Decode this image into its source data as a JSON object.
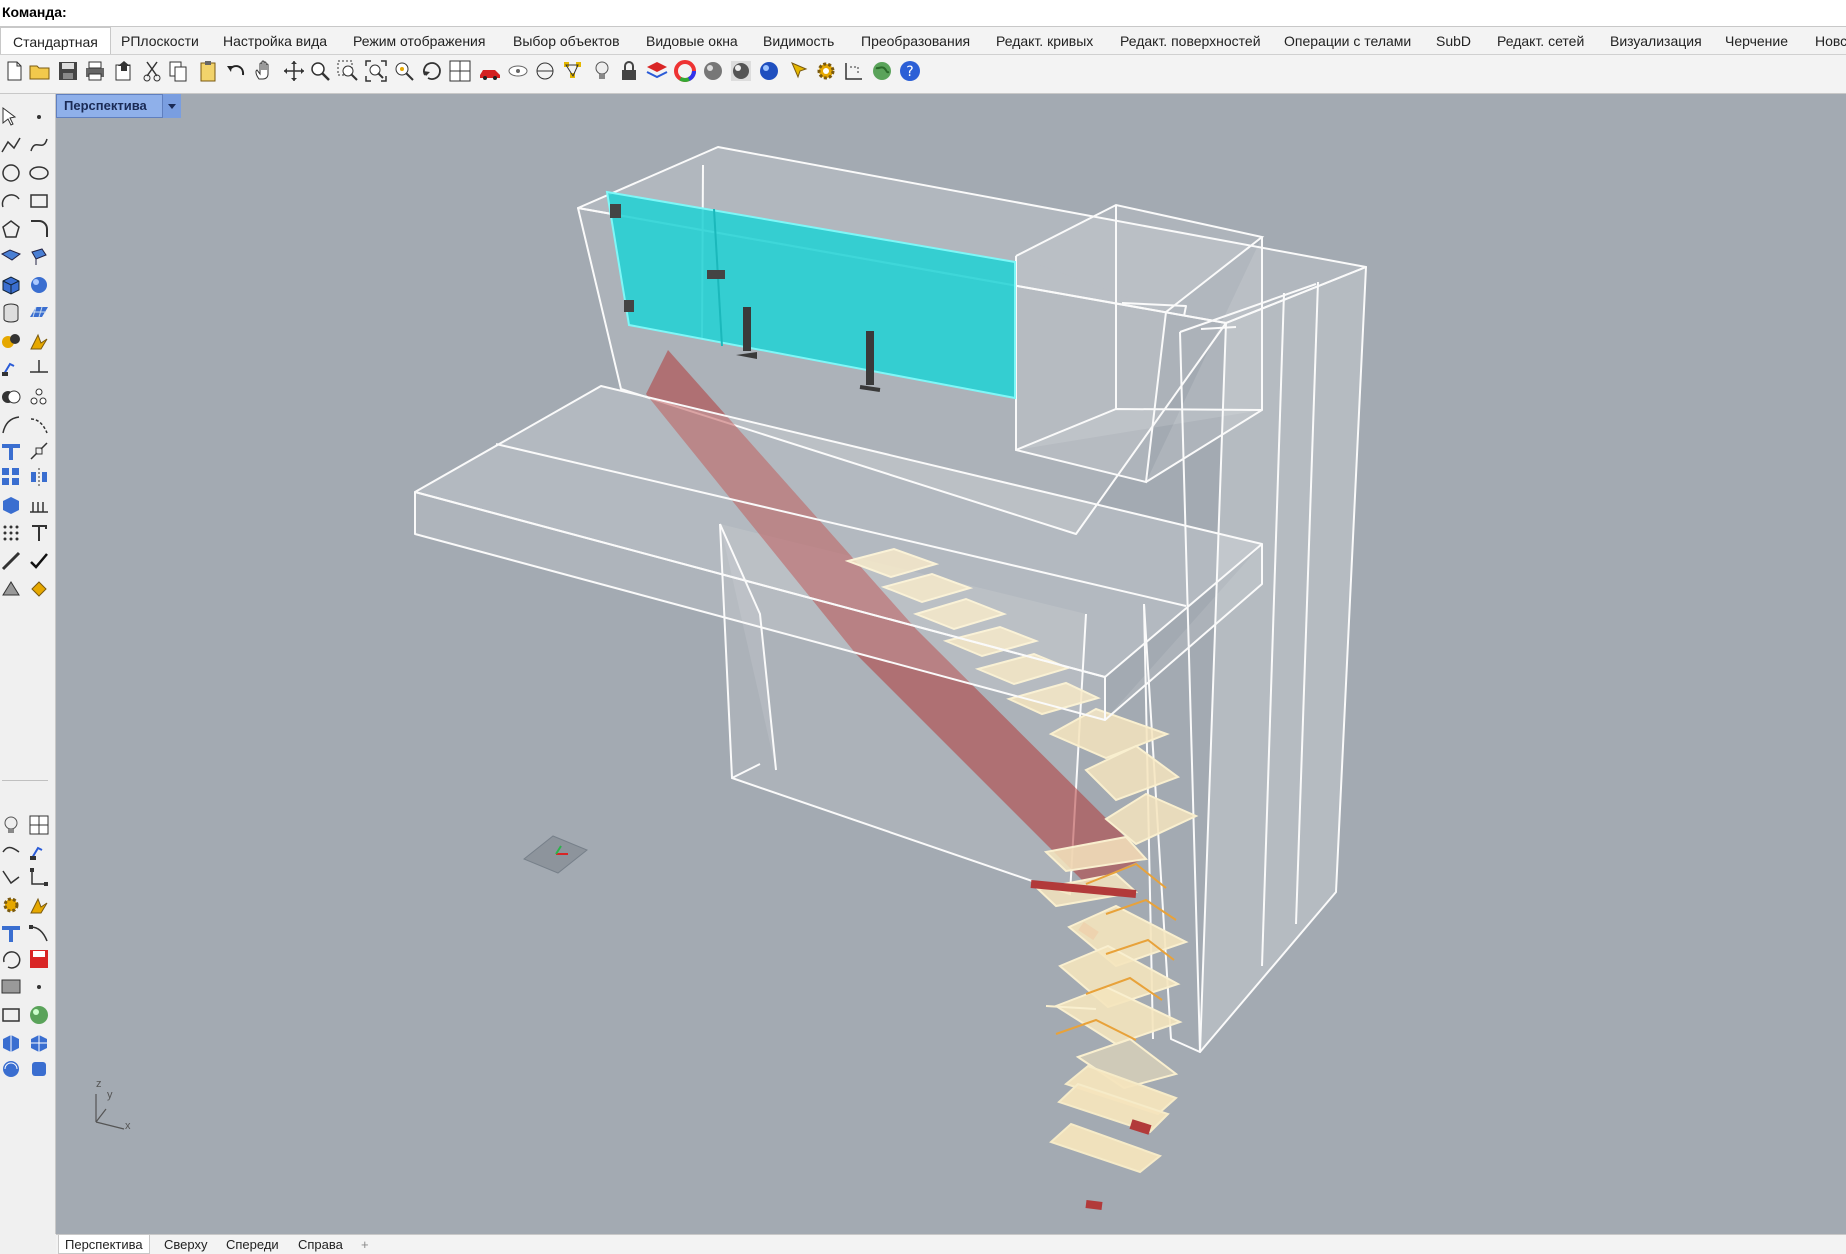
{
  "command": {
    "label": "Команда:"
  },
  "tabs": [
    "Стандартная",
    "РПлоскости",
    "Настройка вида",
    "Режим отображения",
    "Выбор объектов",
    "Видовые окна",
    "Видимость",
    "Преобразования",
    "Редакт. кривых",
    "Редакт. поверхностей",
    "Операции с телами",
    "SubD",
    "Редакт. сетей",
    "Визуализация",
    "Черчение",
    "Новс"
  ],
  "active_tab": "Стандартная",
  "toolbar_icons": [
    "new-file-icon",
    "open-folder-icon",
    "save-icon",
    "print-icon",
    "import-icon",
    "cut-icon",
    "copy-icon",
    "paste-icon",
    "undo-icon",
    "pan-hand-icon",
    "move-icon",
    "zoom-icon",
    "zoom-window-icon",
    "zoom-extents-icon",
    "zoom-selected-icon",
    "rotate-view-icon",
    "viewport-layout-icon",
    "car-icon",
    "hide-icon",
    "cplane-icon",
    "select-points-icon",
    "light-icon",
    "lock-icon",
    "layer-icon",
    "color-wheel-icon",
    "shaded-sphere-icon",
    "rendered-sphere-icon",
    "render-icon",
    "paint-icon",
    "settings-gear-icon",
    "dimension-icon",
    "globe-icon",
    "help-icon"
  ],
  "viewport": {
    "title": "Перспектива",
    "axes": {
      "z": "z",
      "y": "y",
      "x": "x"
    }
  },
  "view_tabs": [
    "Перспектива",
    "Сверху",
    "Спереди",
    "Справа"
  ],
  "active_view_tab": "Перспектива",
  "colors": {
    "viewport_bg": "#a3aab2",
    "glass": "#2ad6d6",
    "stair_tread": "#f4e4bd",
    "stair_stringer": "#b23a3a",
    "wire": "#ffffff"
  }
}
